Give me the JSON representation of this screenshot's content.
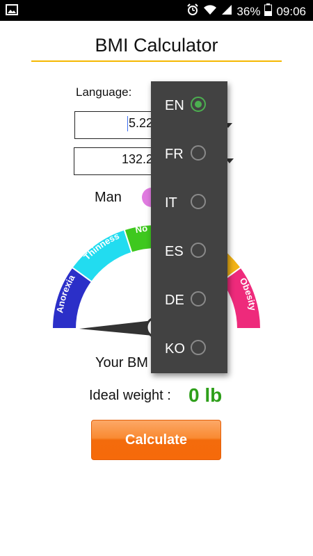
{
  "status_bar": {
    "battery": "36%",
    "time": "09:06",
    "icons": [
      "gallery-icon",
      "alarm-icon",
      "wifi-icon",
      "signal-icon",
      "battery-icon"
    ]
  },
  "app": {
    "title": "BMI Calculator",
    "language_label": "Language:",
    "height_value": "5.22",
    "weight_value": "132.2",
    "gender_label": "Man",
    "your_bmi_label": "Your BM",
    "ideal_weight_label": "Ideal weight :",
    "ideal_weight_value": "0 lb",
    "calculate_label": "Calculate"
  },
  "gauge": {
    "segments": [
      {
        "label": "Anorexia",
        "color": "#2b2fc8"
      },
      {
        "label": "Thinness",
        "color": "#22dcf0"
      },
      {
        "label": "No",
        "color": "#3ec81e"
      },
      {
        "label": "",
        "color": "#f2b316"
      },
      {
        "label": "Obesity",
        "color": "#ee2a7b"
      }
    ]
  },
  "language_menu": {
    "selected": "EN",
    "options": [
      {
        "code": "EN"
      },
      {
        "code": "FR"
      },
      {
        "code": "IT"
      },
      {
        "code": "ES"
      },
      {
        "code": "DE"
      },
      {
        "code": "KO"
      }
    ]
  },
  "colors": {
    "accent_rule": "#f5b800",
    "ideal_value": "#2e9f1a",
    "button": "#f66a0a",
    "radio_checked": "#4caf50",
    "menu_bg": "#424242"
  }
}
